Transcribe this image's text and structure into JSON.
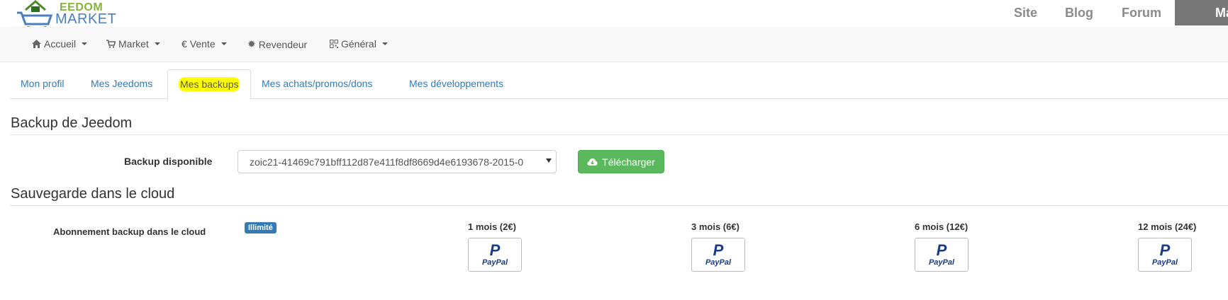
{
  "header": {
    "logo_line1": "EEDOM",
    "logo_line2": "MARKET",
    "links": [
      "Site",
      "Blog",
      "Forum"
    ],
    "dark_label": "Ma"
  },
  "navbar": {
    "items": [
      {
        "icon": "home-icon",
        "label": "Accueil"
      },
      {
        "icon": "cart-icon",
        "label": "Market"
      },
      {
        "icon": "euro-icon",
        "label": "Vente"
      },
      {
        "icon": "gear-icon",
        "label": "Revendeur"
      },
      {
        "icon": "qrcode-icon",
        "label": "Général"
      }
    ]
  },
  "tabs": {
    "items": [
      "Mon profil",
      "Mes Jeedoms",
      "Mes backups",
      "Mes achats/promos/dons",
      "Mes développements"
    ],
    "active": "Mes backups"
  },
  "backup": {
    "title": "Backup de Jeedom",
    "label": "Backup disponible",
    "selected": "zoic21-41469c791bff112d87e411f8df8669d4e6193678-2015-0",
    "download_button": "Télécharger"
  },
  "cloud": {
    "title": "Sauvegarde dans le cloud",
    "label": "Abonnement backup dans le cloud",
    "badge": "Illimité",
    "plans": [
      "1 mois (2€)",
      "3 mois (6€)",
      "6 mois (12€)",
      "12 mois (24€)"
    ],
    "paypal_label": "PayPal"
  },
  "colors": {
    "accent": "#337ab7",
    "success": "#5cb85c",
    "highlight": "#ffff00"
  }
}
